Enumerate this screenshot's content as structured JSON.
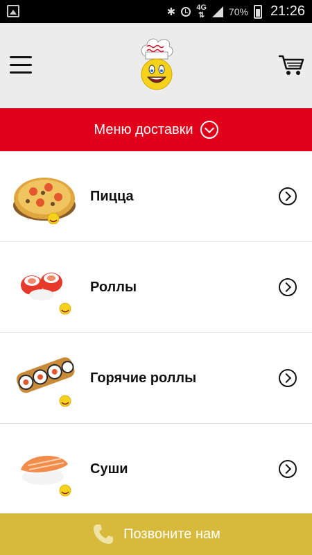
{
  "status_bar": {
    "network": "4G",
    "battery": "70%",
    "time": "21:26"
  },
  "header": {
    "delivery_menu_label": "Меню доставки"
  },
  "categories": [
    {
      "name": "Пицца"
    },
    {
      "name": "Роллы"
    },
    {
      "name": "Горячие роллы"
    },
    {
      "name": "Суши"
    }
  ],
  "call_bar": {
    "label": "Позвоните нам"
  },
  "colors": {
    "accent_red": "#e1001a",
    "call_bar_gold": "#d7b93c",
    "header_bg": "#ececec"
  },
  "icons": {
    "menu": "hamburger-icon",
    "cart": "cart-icon",
    "chevron": "chevron-right-circle-icon",
    "phone": "phone-icon"
  }
}
